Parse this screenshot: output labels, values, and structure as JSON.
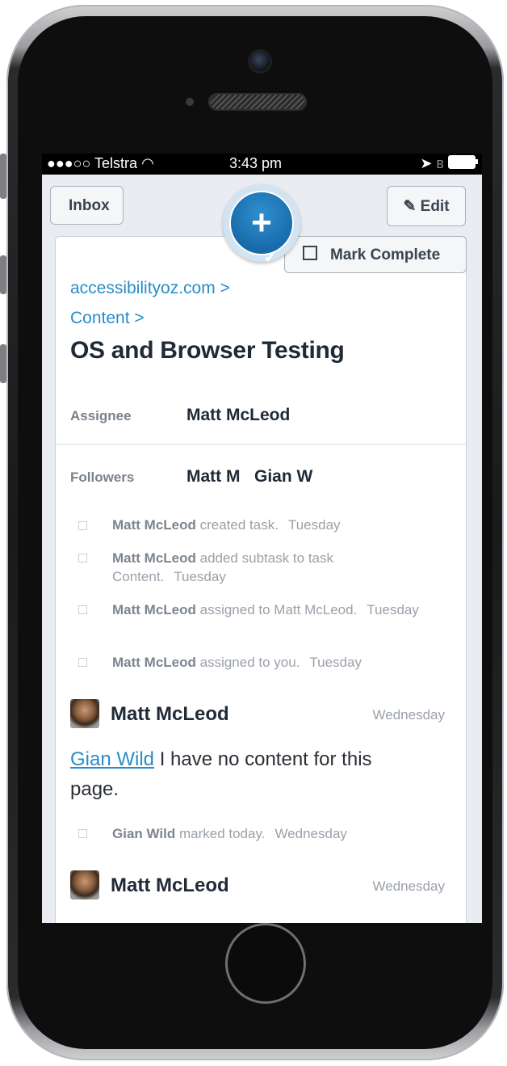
{
  "status_bar": {
    "carrier": "●●●○○ Telstra",
    "wifi_icon": "wifi-icon",
    "time": "3:43 pm",
    "location_icon": "location-icon",
    "bluetooth_icon": "bluetooth-icon"
  },
  "nav": {
    "back_label": "Inbox",
    "edit_label": "Edit",
    "add_icon": "add-task-icon"
  },
  "task": {
    "mark_complete_label": "Mark Complete",
    "breadcrumbs": [
      "accessibilityoz.com >",
      "Content >"
    ],
    "title": "OS and Browser Testing",
    "assignee_label": "Assignee",
    "assignee": "Matt McLeod",
    "followers_label": "Followers",
    "followers": "Matt M   Gian W"
  },
  "activity": [
    {
      "who": "Matt McLeod",
      "what": " created task.",
      "when": "Tuesday"
    },
    {
      "who": "Matt McLeod",
      "what": " added subtask to task Content.",
      "when": "Tuesday"
    },
    {
      "who": "Matt McLeod",
      "what": " assigned to Matt McLeod.",
      "when": "Tuesday"
    },
    {
      "who": "Matt McLeod",
      "what": " assigned to you.",
      "when": "Tuesday"
    }
  ],
  "comments": [
    {
      "author": "Matt McLeod",
      "when": "Wednesday",
      "mention": "Gian Wild",
      "text": " I have no content for this page."
    },
    {
      "author": "Matt McLeod",
      "when": "Wednesday"
    }
  ],
  "activity_2": {
    "who": "Gian Wild",
    "what": " marked today.",
    "when": "Wednesday"
  }
}
